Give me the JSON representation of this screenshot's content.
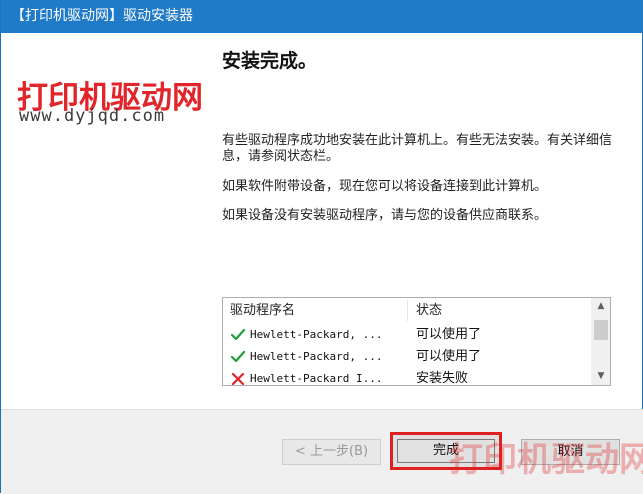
{
  "window": {
    "title": "【打印机驱动网】驱动安装器"
  },
  "logo": {
    "name": "打印机驱动网",
    "url": "www.dyjqd.com"
  },
  "heading": "安装完成。",
  "paragraphs": [
    "有些驱动程序成功地安装在此计算机上。有些无法安装。有关详细信息，请参阅状态栏。",
    "如果软件附带设备，现在您可以将设备连接到此计算机。",
    "如果设备没有安装驱动程序，请与您的设备供应商联系。"
  ],
  "list": {
    "columns": [
      "驱动程序名",
      "状态"
    ],
    "rows": [
      {
        "icon": "check-icon",
        "name": "Hewlett-Packard, ...",
        "status": "可以使用了"
      },
      {
        "icon": "check-icon",
        "name": "Hewlett-Packard, ...",
        "status": "可以使用了"
      },
      {
        "icon": "cross-icon",
        "name": "Hewlett-Packard I...",
        "status": "安装失败"
      }
    ]
  },
  "buttons": {
    "back": "< 上一步(B)",
    "finish": "完成",
    "cancel": "取消"
  },
  "watermark": "打印机驱动网",
  "colors": {
    "titlebar": "#1f7ac8",
    "logo_red": "#e0262b",
    "highlight_border": "#e02020",
    "check": "#1e9e3a",
    "cross": "#e0262b"
  }
}
